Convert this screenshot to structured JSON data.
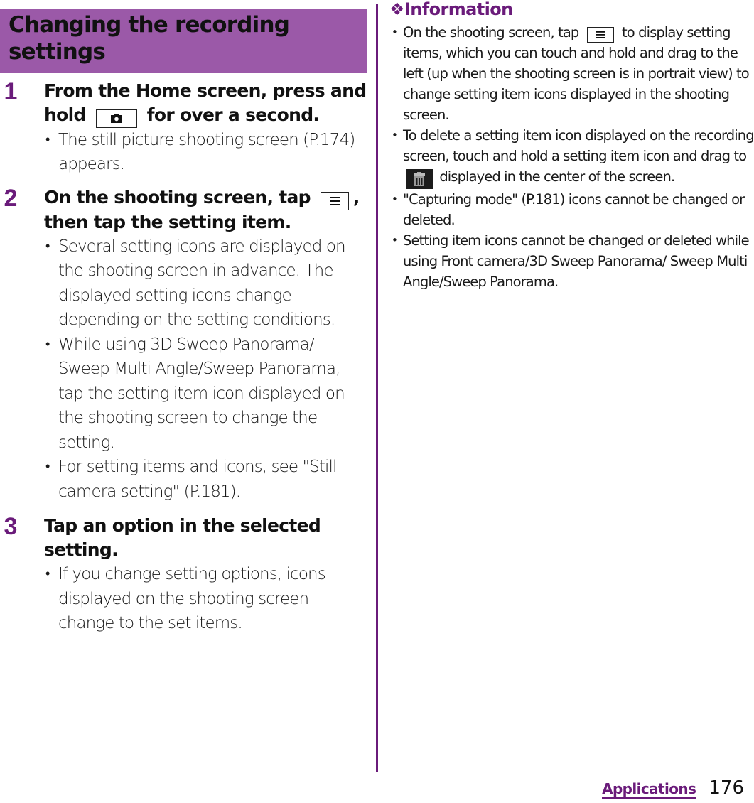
{
  "section": {
    "title": "Changing the recording settings"
  },
  "steps": [
    {
      "number": "1",
      "title_before": "From the Home screen, press and hold",
      "icon": "camera-key-icon",
      "title_after": "for over a second.",
      "bullets": [
        "The still picture shooting screen (P.174) appears."
      ]
    },
    {
      "number": "2",
      "title_before": "On the shooting screen, tap",
      "icon": "menu-key-icon",
      "title_after": ", then tap the setting item.",
      "bullets": [
        "Several setting icons are displayed on the shooting screen in advance. The displayed setting icons change depending on the setting conditions.",
        "While using 3D Sweep Panorama/ Sweep Multi Angle/Sweep Panorama, tap the setting item icon displayed on the shooting screen to change the setting.",
        "For setting items and icons, see \"Still camera setting\" (P.181)."
      ]
    },
    {
      "number": "3",
      "title": "Tap an option in the selected setting.",
      "bullets": [
        "If you change setting options, icons displayed on the shooting screen change to the set items."
      ]
    }
  ],
  "information": {
    "title_symbol": "❖",
    "title": "Information",
    "items": [
      {
        "before": "On the shooting screen, tap",
        "icon": "menu-key-icon",
        "after": "to display setting items, which you can touch and hold and drag to the left (up when the shooting screen is in portrait view) to change setting item icons displayed in the shooting screen."
      },
      {
        "before": "To delete a setting item icon displayed on the recording screen, touch and hold a setting item icon and drag to",
        "icon": "trash-icon",
        "after": "displayed in the center of the screen."
      },
      {
        "text": "\"Capturing mode\" (P.181) icons cannot be changed or deleted."
      },
      {
        "text": "Setting item icons cannot be changed or deleted while using Front camera/3D Sweep Panorama/ Sweep Multi Angle/Sweep Panorama."
      }
    ]
  },
  "footer": {
    "section_name": "Applications",
    "page_number": "176"
  },
  "colors": {
    "header_background": "#9b59a8",
    "accent_purple": "#6a1b7a"
  }
}
